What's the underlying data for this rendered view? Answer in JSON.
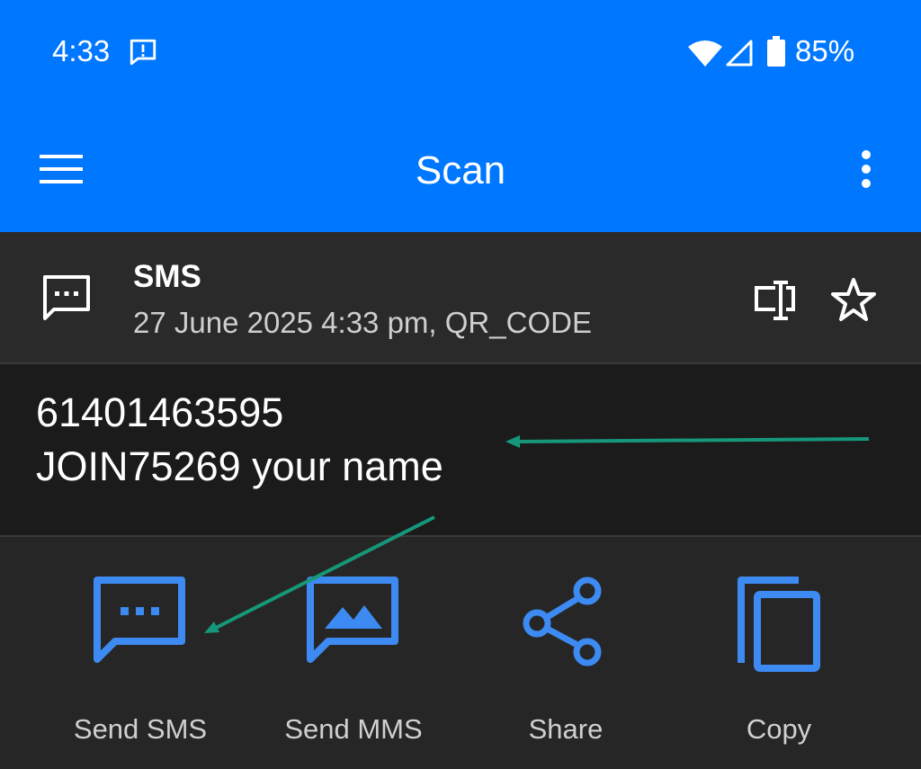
{
  "status_bar": {
    "time": "4:33",
    "battery": "85%"
  },
  "toolbar": {
    "title": "Scan"
  },
  "result": {
    "type": "SMS",
    "meta": "27 June 2025 4:33 pm, QR_CODE",
    "content_line1": "61401463595",
    "content_line2": "JOIN75269 your name"
  },
  "actions": [
    {
      "label": "Send SMS",
      "icon": "sms-icon"
    },
    {
      "label": "Send MMS",
      "icon": "image-message-icon"
    },
    {
      "label": "Share",
      "icon": "share-icon"
    },
    {
      "label": "Copy",
      "icon": "copy-icon"
    }
  ],
  "colors": {
    "appbar": "#0077FF",
    "accent": "#3D8BF2",
    "annotation_arrow": "#16977A",
    "background": "#222222"
  }
}
